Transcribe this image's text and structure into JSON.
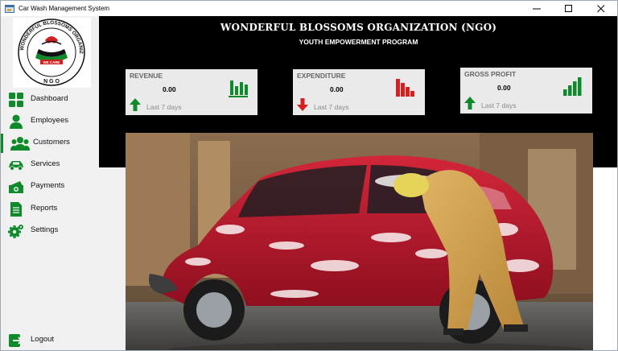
{
  "window": {
    "title": "Car Wash Management System",
    "controls": {
      "minimize": "minimize",
      "maximize": "maximize",
      "close": "close"
    }
  },
  "logo": {
    "arc_text": "WONDERFUL BLOSSOMS ORGANIZATION",
    "banner_text": "WE CARE",
    "bottom_text": "N G O"
  },
  "sidebar": {
    "items": [
      {
        "label": "Dashboard",
        "icon": "dashboard-icon"
      },
      {
        "label": "Employees",
        "icon": "employee-icon"
      },
      {
        "label": "Customers",
        "icon": "customers-icon",
        "active": true
      },
      {
        "label": "Services",
        "icon": "car-icon"
      },
      {
        "label": "Payments",
        "icon": "money-icon"
      },
      {
        "label": "Reports",
        "icon": "report-icon"
      },
      {
        "label": "Settings",
        "icon": "gear-icon"
      }
    ],
    "logout": {
      "label": "Logout",
      "icon": "logout-icon"
    }
  },
  "header": {
    "org_name": "WONDERFUL BLOSSOMS ORGANIZATION (NGO)",
    "program": "YOUTH EMPOWERMENT PROGRAM"
  },
  "cards": [
    {
      "title": "REVENUE",
      "value": "0.00",
      "period": "Last 7 days",
      "trend": "up",
      "chart_color": "#0f8a2a"
    },
    {
      "title": "EXPENDITURE",
      "value": "0.00",
      "period": "Last 7 days",
      "trend": "down",
      "chart_color": "#d32020"
    },
    {
      "title": "GROSS PROFIT",
      "value": "0.00",
      "period": "Last 7 days",
      "trend": "up",
      "chart_color": "#0f8a2a"
    }
  ],
  "colors": {
    "accent_green": "#0f8a2a",
    "accent_red": "#d32020",
    "header_bg": "#000000"
  }
}
